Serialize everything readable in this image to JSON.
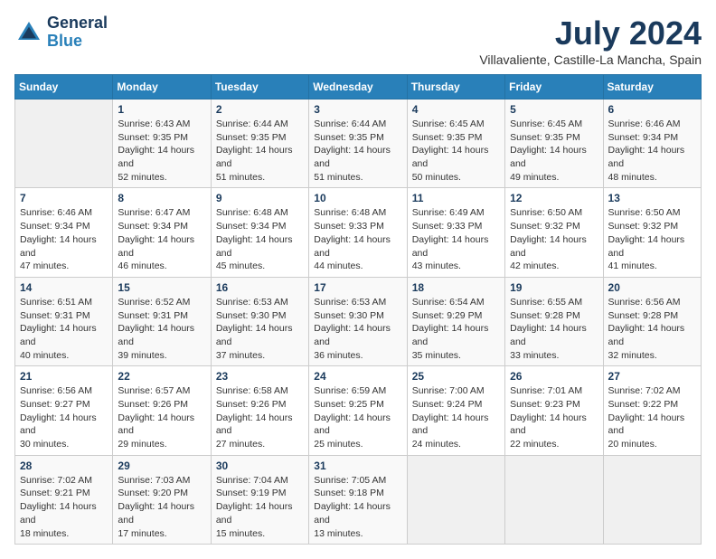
{
  "header": {
    "logo_line1": "General",
    "logo_line2": "Blue",
    "month_title": "July 2024",
    "location": "Villavaliente, Castille-La Mancha, Spain"
  },
  "weekdays": [
    "Sunday",
    "Monday",
    "Tuesday",
    "Wednesday",
    "Thursday",
    "Friday",
    "Saturday"
  ],
  "weeks": [
    [
      {
        "day": "",
        "sunrise": "",
        "sunset": "",
        "daylight": ""
      },
      {
        "day": "1",
        "sunrise": "Sunrise: 6:43 AM",
        "sunset": "Sunset: 9:35 PM",
        "daylight": "Daylight: 14 hours and 52 minutes."
      },
      {
        "day": "2",
        "sunrise": "Sunrise: 6:44 AM",
        "sunset": "Sunset: 9:35 PM",
        "daylight": "Daylight: 14 hours and 51 minutes."
      },
      {
        "day": "3",
        "sunrise": "Sunrise: 6:44 AM",
        "sunset": "Sunset: 9:35 PM",
        "daylight": "Daylight: 14 hours and 51 minutes."
      },
      {
        "day": "4",
        "sunrise": "Sunrise: 6:45 AM",
        "sunset": "Sunset: 9:35 PM",
        "daylight": "Daylight: 14 hours and 50 minutes."
      },
      {
        "day": "5",
        "sunrise": "Sunrise: 6:45 AM",
        "sunset": "Sunset: 9:35 PM",
        "daylight": "Daylight: 14 hours and 49 minutes."
      },
      {
        "day": "6",
        "sunrise": "Sunrise: 6:46 AM",
        "sunset": "Sunset: 9:34 PM",
        "daylight": "Daylight: 14 hours and 48 minutes."
      }
    ],
    [
      {
        "day": "7",
        "sunrise": "Sunrise: 6:46 AM",
        "sunset": "Sunset: 9:34 PM",
        "daylight": "Daylight: 14 hours and 47 minutes."
      },
      {
        "day": "8",
        "sunrise": "Sunrise: 6:47 AM",
        "sunset": "Sunset: 9:34 PM",
        "daylight": "Daylight: 14 hours and 46 minutes."
      },
      {
        "day": "9",
        "sunrise": "Sunrise: 6:48 AM",
        "sunset": "Sunset: 9:34 PM",
        "daylight": "Daylight: 14 hours and 45 minutes."
      },
      {
        "day": "10",
        "sunrise": "Sunrise: 6:48 AM",
        "sunset": "Sunset: 9:33 PM",
        "daylight": "Daylight: 14 hours and 44 minutes."
      },
      {
        "day": "11",
        "sunrise": "Sunrise: 6:49 AM",
        "sunset": "Sunset: 9:33 PM",
        "daylight": "Daylight: 14 hours and 43 minutes."
      },
      {
        "day": "12",
        "sunrise": "Sunrise: 6:50 AM",
        "sunset": "Sunset: 9:32 PM",
        "daylight": "Daylight: 14 hours and 42 minutes."
      },
      {
        "day": "13",
        "sunrise": "Sunrise: 6:50 AM",
        "sunset": "Sunset: 9:32 PM",
        "daylight": "Daylight: 14 hours and 41 minutes."
      }
    ],
    [
      {
        "day": "14",
        "sunrise": "Sunrise: 6:51 AM",
        "sunset": "Sunset: 9:31 PM",
        "daylight": "Daylight: 14 hours and 40 minutes."
      },
      {
        "day": "15",
        "sunrise": "Sunrise: 6:52 AM",
        "sunset": "Sunset: 9:31 PM",
        "daylight": "Daylight: 14 hours and 39 minutes."
      },
      {
        "day": "16",
        "sunrise": "Sunrise: 6:53 AM",
        "sunset": "Sunset: 9:30 PM",
        "daylight": "Daylight: 14 hours and 37 minutes."
      },
      {
        "day": "17",
        "sunrise": "Sunrise: 6:53 AM",
        "sunset": "Sunset: 9:30 PM",
        "daylight": "Daylight: 14 hours and 36 minutes."
      },
      {
        "day": "18",
        "sunrise": "Sunrise: 6:54 AM",
        "sunset": "Sunset: 9:29 PM",
        "daylight": "Daylight: 14 hours and 35 minutes."
      },
      {
        "day": "19",
        "sunrise": "Sunrise: 6:55 AM",
        "sunset": "Sunset: 9:28 PM",
        "daylight": "Daylight: 14 hours and 33 minutes."
      },
      {
        "day": "20",
        "sunrise": "Sunrise: 6:56 AM",
        "sunset": "Sunset: 9:28 PM",
        "daylight": "Daylight: 14 hours and 32 minutes."
      }
    ],
    [
      {
        "day": "21",
        "sunrise": "Sunrise: 6:56 AM",
        "sunset": "Sunset: 9:27 PM",
        "daylight": "Daylight: 14 hours and 30 minutes."
      },
      {
        "day": "22",
        "sunrise": "Sunrise: 6:57 AM",
        "sunset": "Sunset: 9:26 PM",
        "daylight": "Daylight: 14 hours and 29 minutes."
      },
      {
        "day": "23",
        "sunrise": "Sunrise: 6:58 AM",
        "sunset": "Sunset: 9:26 PM",
        "daylight": "Daylight: 14 hours and 27 minutes."
      },
      {
        "day": "24",
        "sunrise": "Sunrise: 6:59 AM",
        "sunset": "Sunset: 9:25 PM",
        "daylight": "Daylight: 14 hours and 25 minutes."
      },
      {
        "day": "25",
        "sunrise": "Sunrise: 7:00 AM",
        "sunset": "Sunset: 9:24 PM",
        "daylight": "Daylight: 14 hours and 24 minutes."
      },
      {
        "day": "26",
        "sunrise": "Sunrise: 7:01 AM",
        "sunset": "Sunset: 9:23 PM",
        "daylight": "Daylight: 14 hours and 22 minutes."
      },
      {
        "day": "27",
        "sunrise": "Sunrise: 7:02 AM",
        "sunset": "Sunset: 9:22 PM",
        "daylight": "Daylight: 14 hours and 20 minutes."
      }
    ],
    [
      {
        "day": "28",
        "sunrise": "Sunrise: 7:02 AM",
        "sunset": "Sunset: 9:21 PM",
        "daylight": "Daylight: 14 hours and 18 minutes."
      },
      {
        "day": "29",
        "sunrise": "Sunrise: 7:03 AM",
        "sunset": "Sunset: 9:20 PM",
        "daylight": "Daylight: 14 hours and 17 minutes."
      },
      {
        "day": "30",
        "sunrise": "Sunrise: 7:04 AM",
        "sunset": "Sunset: 9:19 PM",
        "daylight": "Daylight: 14 hours and 15 minutes."
      },
      {
        "day": "31",
        "sunrise": "Sunrise: 7:05 AM",
        "sunset": "Sunset: 9:18 PM",
        "daylight": "Daylight: 14 hours and 13 minutes."
      },
      {
        "day": "",
        "sunrise": "",
        "sunset": "",
        "daylight": ""
      },
      {
        "day": "",
        "sunrise": "",
        "sunset": "",
        "daylight": ""
      },
      {
        "day": "",
        "sunrise": "",
        "sunset": "",
        "daylight": ""
      }
    ]
  ]
}
